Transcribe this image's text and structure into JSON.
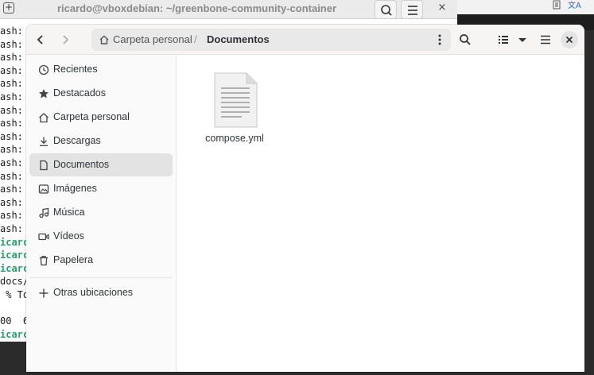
{
  "terminal": {
    "title": "ricardo@vboxdebian: ~/greenbone-community-container",
    "close_glyph": "×",
    "new_tab_glyph": "+",
    "lines": [
      {
        "text": "ash:",
        "green": false
      },
      {
        "text": "ash:",
        "green": false
      },
      {
        "text": "ash:",
        "green": false
      },
      {
        "text": "ash:",
        "green": false
      },
      {
        "text": "ash:",
        "green": false
      },
      {
        "text": "ash:",
        "green": false
      },
      {
        "text": "ash:",
        "green": false
      },
      {
        "text": "ash:",
        "green": false
      },
      {
        "text": "ash:",
        "green": false
      },
      {
        "text": "ash:",
        "green": false
      },
      {
        "text": "ash:",
        "green": false
      },
      {
        "text": "ash:",
        "green": false
      },
      {
        "text": "ash:",
        "green": false
      },
      {
        "text": "ash:",
        "green": false
      },
      {
        "text": "ash:",
        "green": false
      },
      {
        "text": "ash:",
        "green": false
      },
      {
        "text": "icarc",
        "green": true
      },
      {
        "text": "icarc",
        "green": true
      },
      {
        "text": "icarc",
        "green": true
      },
      {
        "text": "docs/",
        "green": false
      },
      {
        "text": " % To",
        "green": false
      },
      {
        "text": "",
        "green": false
      },
      {
        "text": "00  6",
        "green": false
      },
      {
        "text": "icarc",
        "green": true
      }
    ]
  },
  "files": {
    "path": {
      "home_label": "Carpeta personal",
      "separator": "/",
      "current_label": "Documentos"
    },
    "close_glyph": "×",
    "sidebar": {
      "items": [
        {
          "label": "Recientes",
          "icon": "clock-icon"
        },
        {
          "label": "Destacados",
          "icon": "star-icon"
        },
        {
          "label": "Carpeta personal",
          "icon": "home-icon"
        },
        {
          "label": "Descargas",
          "icon": "download-icon"
        },
        {
          "label": "Documentos",
          "icon": "document-icon",
          "selected": true
        },
        {
          "label": "Imágenes",
          "icon": "image-icon"
        },
        {
          "label": "Música",
          "icon": "music-icon"
        },
        {
          "label": "Vídeos",
          "icon": "video-icon"
        },
        {
          "label": "Papelera",
          "icon": "trash-icon"
        }
      ],
      "other_locations_label": "Otras ubicaciones"
    },
    "content": {
      "items": [
        {
          "name": "compose.yml",
          "icon": "text-file-icon"
        }
      ]
    }
  },
  "colors": {
    "terminal_prompt_green": "#26a269",
    "selection_bg": "#e3e3e3"
  }
}
